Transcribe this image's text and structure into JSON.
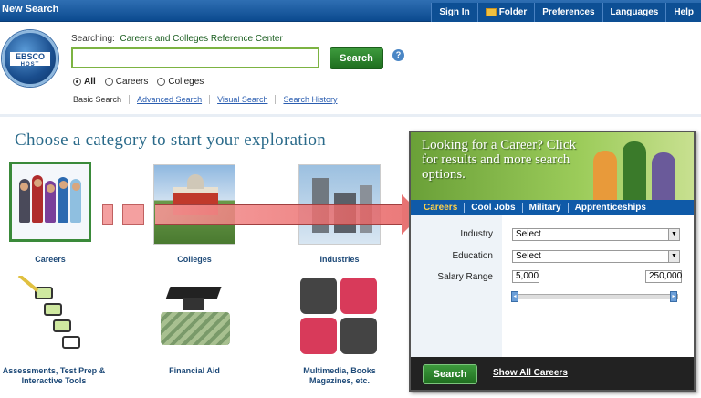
{
  "topbar": {
    "new_search": "New Search",
    "nav": [
      "Sign In",
      "Folder",
      "Preferences",
      "Languages",
      "Help"
    ]
  },
  "logo": {
    "line1": "EBSCO",
    "line2": "HOST"
  },
  "search": {
    "searching_label": "Searching:",
    "database": "Careers and Colleges Reference Center",
    "query": "",
    "button": "Search",
    "help": "?",
    "options": [
      "All",
      "Careers",
      "Colleges"
    ],
    "selected_option": "All",
    "links": [
      "Basic Search",
      "Advanced Search",
      "Visual Search",
      "Search History"
    ]
  },
  "heading": "Choose a category to start your exploration",
  "categories": [
    {
      "label": "Careers",
      "selected": true
    },
    {
      "label": "Colleges"
    },
    {
      "label": "Industries"
    },
    {
      "label": "Assessments, Test Prep & Interactive Tools"
    },
    {
      "label": "Financial Aid"
    },
    {
      "label": "Multimedia, Books Magazines, etc."
    }
  ],
  "panel": {
    "banner": "Looking for a Career? Click for results and more search options.",
    "tabs": [
      "Careers",
      "Cool Jobs",
      "Military",
      "Apprenticeships"
    ],
    "active_tab": "Careers",
    "fields": [
      {
        "label": "Industry",
        "value": "Select"
      },
      {
        "label": "Education",
        "value": "Select"
      }
    ],
    "salary_label": "Salary Range",
    "salary_min": "5,000",
    "salary_max": "250,000",
    "search_button": "Search",
    "show_all": "Show All Careers"
  },
  "colors": {
    "accent_green": "#2e7d32",
    "nav_blue": "#0f5aa8",
    "heading": "#2a6a8a"
  }
}
